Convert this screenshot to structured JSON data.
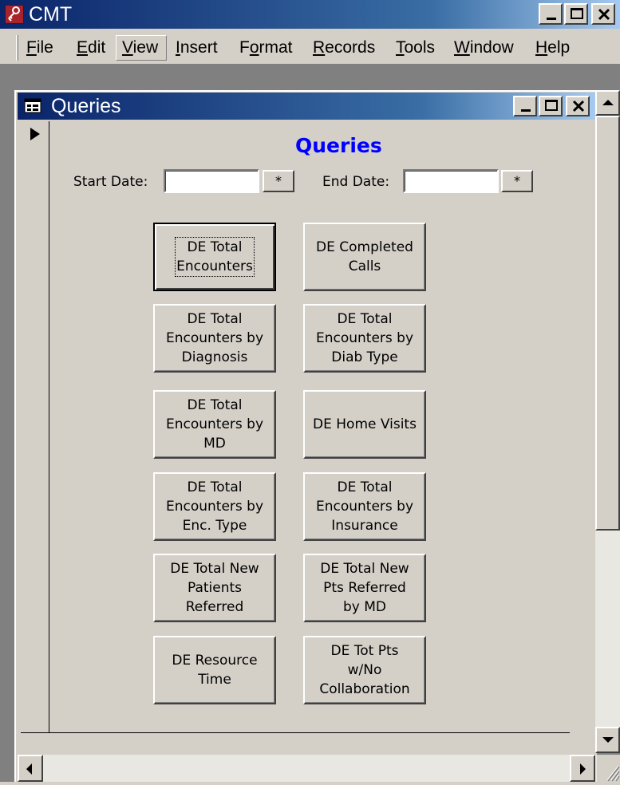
{
  "app": {
    "title": "CMT",
    "icon": "access-key-icon",
    "title_bar_color": "#0a246a"
  },
  "menu": {
    "items": [
      {
        "label": "File",
        "underline": "F",
        "rest": "ile"
      },
      {
        "label": "Edit",
        "underline": "E",
        "rest": "dit"
      },
      {
        "label": "View",
        "underline": "V",
        "rest": "iew"
      },
      {
        "label": "Insert",
        "underline": "I",
        "rest": "nsert"
      },
      {
        "label": "Format",
        "pre": "F",
        "underline": "o",
        "rest": "rmat"
      },
      {
        "label": "Records",
        "underline": "R",
        "rest": "ecords"
      },
      {
        "label": "Tools",
        "underline": "T",
        "rest": "ools"
      },
      {
        "label": "Window",
        "underline": "W",
        "rest": "indow"
      },
      {
        "label": "Help",
        "underline": "H",
        "rest": "elp"
      }
    ]
  },
  "child_window": {
    "title": "Queries",
    "icon": "form-icon"
  },
  "form": {
    "heading": "Queries",
    "heading_color": "#0000ff",
    "start_date_label": "Start Date:",
    "start_date_value": "",
    "end_date_label": "End Date:",
    "end_date_value": "",
    "star_label": "*"
  },
  "query_buttons": [
    {
      "label": "DE Total\nEncounters",
      "default": true
    },
    {
      "label": "DE Completed\nCalls"
    },
    {
      "label": "DE Total\nEncounters by\nDiagnosis"
    },
    {
      "label": "DE Total\nEncounters by\nDiab Type"
    },
    {
      "label": "DE Total\nEncounters by\nMD"
    },
    {
      "label": "DE Home Visits"
    },
    {
      "label": "DE Total\nEncounters by\nEnc. Type"
    },
    {
      "label": "DE Total\nEncounters by\nInsurance"
    },
    {
      "label": "DE Total New\nPatients\nReferred"
    },
    {
      "label": "DE Total New\nPts Referred\nby MD"
    },
    {
      "label": "DE Resource\nTime"
    },
    {
      "label": "DE Tot Pts\nw/No\nCollaboration"
    }
  ]
}
